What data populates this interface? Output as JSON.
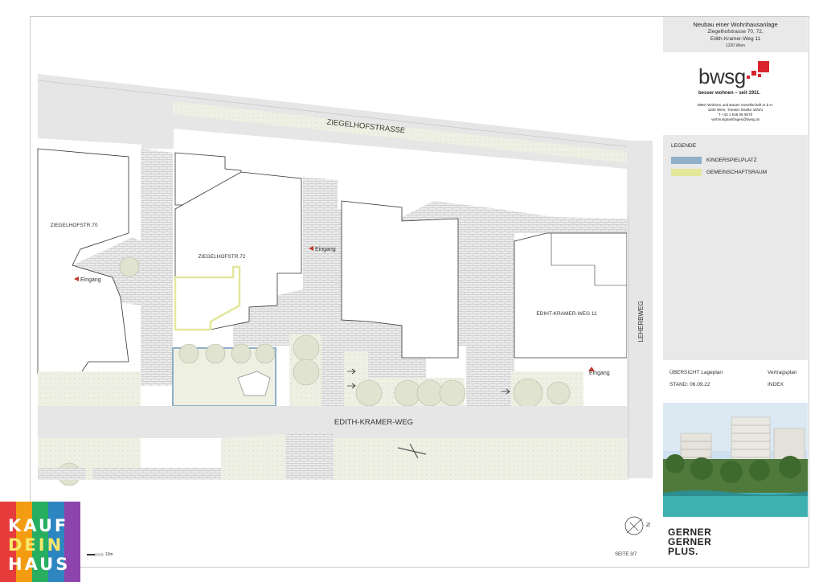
{
  "header": {
    "title": "Neubau einer Wohnhausanlage",
    "address1": "Ziegelhofstrasse 70, 72,",
    "address2": "Edith-Kramer-Weg 11",
    "city": "1220 Wien"
  },
  "logo": {
    "brand": "bwsg",
    "tagline": "besser wohnen – seit 1911.",
    "company": "WBG Wohnen und Bauen Gesellschaft m.b.H.",
    "street": "1100 Wien, Triester Straße 40/3/1",
    "phone": "T +43 1 546 08 9070",
    "email": "wohnungsanfragen@bwsg.at"
  },
  "legend": {
    "title": "LEGENDE",
    "items": [
      {
        "label": "KINDERSPIELPLATZ",
        "color": "#8fb0c8"
      },
      {
        "label": "GEMEINSCHAFTSRAUM",
        "color": "#e3e79a"
      }
    ]
  },
  "info": {
    "plan_label": "ÜBERSICHT Lageplan",
    "stand": "STAND: 06.09.22",
    "plan_type": "Vertragsplan",
    "index": "INDEX"
  },
  "footer": {
    "architect_line1": "GERNER",
    "architect_line2": "GERNER",
    "architect_line3": "PLUS."
  },
  "plan": {
    "street_top": "ZIEGELHOFSTRASSE",
    "street_bottom": "EDITH-KRAMER-WEG",
    "street_right": "LEHERBWEG",
    "building_1": "ZIEGELHOFSTR.70",
    "building_2": "ZIEGELHOFSTR.72",
    "building_3": "EDIHT-KRAMER-WEG 11",
    "entrance": "Eingang",
    "page": "SEITE 3/7",
    "scale": "10m",
    "north": "N"
  },
  "badge": {
    "line1": "KAUF",
    "line2": "DEIN",
    "line3": "HAUS"
  },
  "colors": {
    "playground": "#8fb0c8",
    "community": "#e3e79a",
    "pavement": "#e2e2e2",
    "green": "#eef0e2"
  }
}
